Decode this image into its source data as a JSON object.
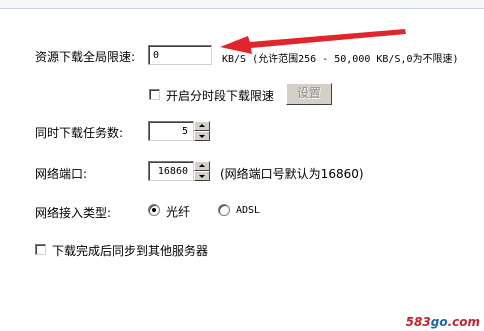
{
  "speed_limit": {
    "label": "资源下载全局限速:",
    "value": "0",
    "unit_hint": "KB/S (允许范围256 - 50,000 KB/S,0为不限速)"
  },
  "schedule": {
    "checkbox_label": "开启分时段下载限速",
    "checked": false,
    "settings_button": "设置"
  },
  "concurrent": {
    "label": "同时下载任务数:",
    "value": "5"
  },
  "port": {
    "label": "网络端口:",
    "value": "16860",
    "hint": "(网络端口号默认为16860)"
  },
  "access_type": {
    "label": "网络接入类型:",
    "options": [
      {
        "label": "光纤",
        "selected": true
      },
      {
        "label": "ADSL",
        "selected": false
      }
    ]
  },
  "sync": {
    "checkbox_label": "下载完成后同步到其他服务器",
    "checked": false
  },
  "watermark": {
    "prefix": "583",
    "middle": "go",
    "suffix": ".com"
  },
  "colors": {
    "arrow": "#e0252d",
    "watermark_red": "#c9202a",
    "watermark_blue": "#1e61b3"
  }
}
